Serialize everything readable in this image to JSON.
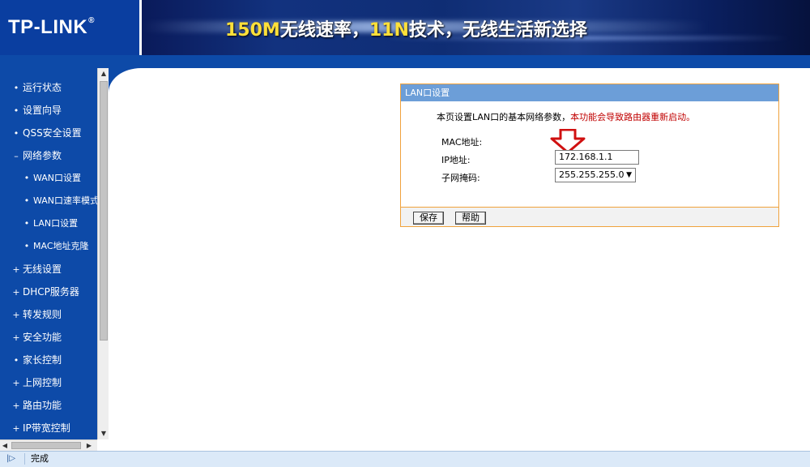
{
  "header": {
    "logo_text": "TP-LINK",
    "logo_mark": "®",
    "banner_part1": "150M",
    "banner_part2": "无线速率，",
    "banner_part3": "11N",
    "banner_part4": "技术，无线生活新选择"
  },
  "sidebar": {
    "items": [
      {
        "label": "运行状态",
        "mark": "•"
      },
      {
        "label": "设置向导",
        "mark": "•"
      },
      {
        "label": "QSS安全设置",
        "mark": "•"
      },
      {
        "label": "网络参数",
        "mark": "–"
      },
      {
        "label": "WAN口设置",
        "mark": "•"
      },
      {
        "label": "WAN口速率模式",
        "mark": "•"
      },
      {
        "label": "LAN口设置",
        "mark": "•"
      },
      {
        "label": "MAC地址克隆",
        "mark": "•"
      },
      {
        "label": "无线设置",
        "mark": "+"
      },
      {
        "label": "DHCP服务器",
        "mark": "+"
      },
      {
        "label": "转发规则",
        "mark": "+"
      },
      {
        "label": "安全功能",
        "mark": "+"
      },
      {
        "label": "家长控制",
        "mark": "•"
      },
      {
        "label": "上网控制",
        "mark": "+"
      },
      {
        "label": "路由功能",
        "mark": "+"
      },
      {
        "label": "IP带宽控制",
        "mark": "+"
      }
    ]
  },
  "panel": {
    "title": "LAN口设置",
    "intro": "本页设置LAN口的基本网络参数，",
    "warning": "本功能会导致路由器重新启动。",
    "mac_label": "MAC地址:",
    "ip_label": "IP地址:",
    "ip_value": "172.168.1.1",
    "mask_label": "子网掩码:",
    "mask_value": "255.255.255.0",
    "save_label": "保存",
    "help_label": "帮助"
  },
  "statusbar": {
    "text": "完成"
  }
}
